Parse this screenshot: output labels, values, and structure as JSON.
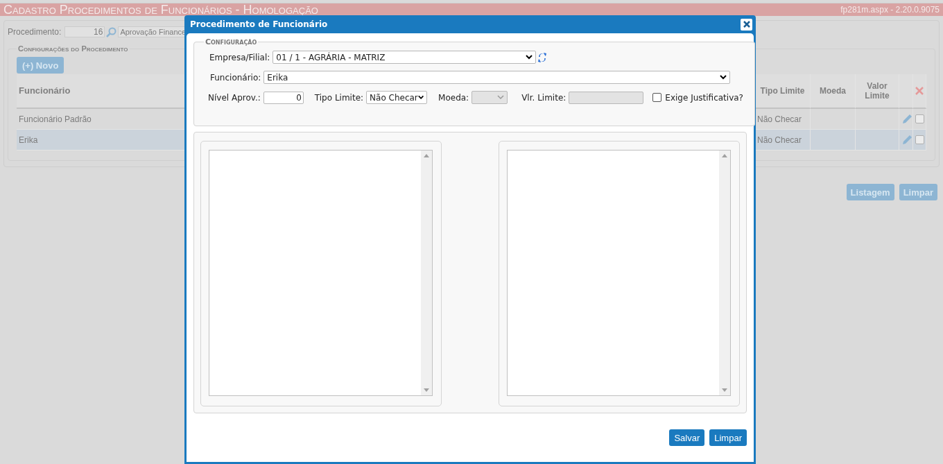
{
  "page": {
    "title": "Cadastro Procedimentos de Funcionários  - Homologação",
    "version": "fp281m.aspx - 2.20.0.9075",
    "procedimento": {
      "label": "Procedimento:",
      "code": "16",
      "description": "Aprovação Finance"
    },
    "section": {
      "legend": "Configurações do Procedimento",
      "new_button": "(+) Novo",
      "columns": [
        "Funcionário",
        "Tipo Limite",
        "Moeda",
        "Valor Limite"
      ],
      "rows": [
        {
          "funcionario": "Funcionário Padrão",
          "tipo_limite": "Não Checar",
          "selected": false,
          "checked": false
        },
        {
          "funcionario": "Erika",
          "tipo_limite": "Não Checar",
          "selected": true,
          "checked": false
        }
      ]
    },
    "buttons": [
      "Listagem",
      "Limpar"
    ]
  },
  "dialog": {
    "title": "Procedimento de Funcionário",
    "config": {
      "legend": "Configuração",
      "empresa": {
        "label": "Empresa/Filial:",
        "value": "01 / 1 - AGRÁRIA - MATRIZ"
      },
      "funcionario": {
        "label": "Funcionário:",
        "value": "Erika"
      },
      "nivel": {
        "label": "Nível Aprov.:",
        "value": "0"
      },
      "tipo_limite": {
        "label": "Tipo Limite:",
        "value": "Não Checar"
      },
      "moeda": {
        "label": "Moeda:",
        "disabled": true
      },
      "vlr_limite": {
        "label": "Vlr. Limite:",
        "disabled": true
      },
      "exige": {
        "label": "Exige Justificativa?",
        "checked": false
      }
    },
    "buttons": [
      "Salvar",
      "Limpar"
    ]
  }
}
